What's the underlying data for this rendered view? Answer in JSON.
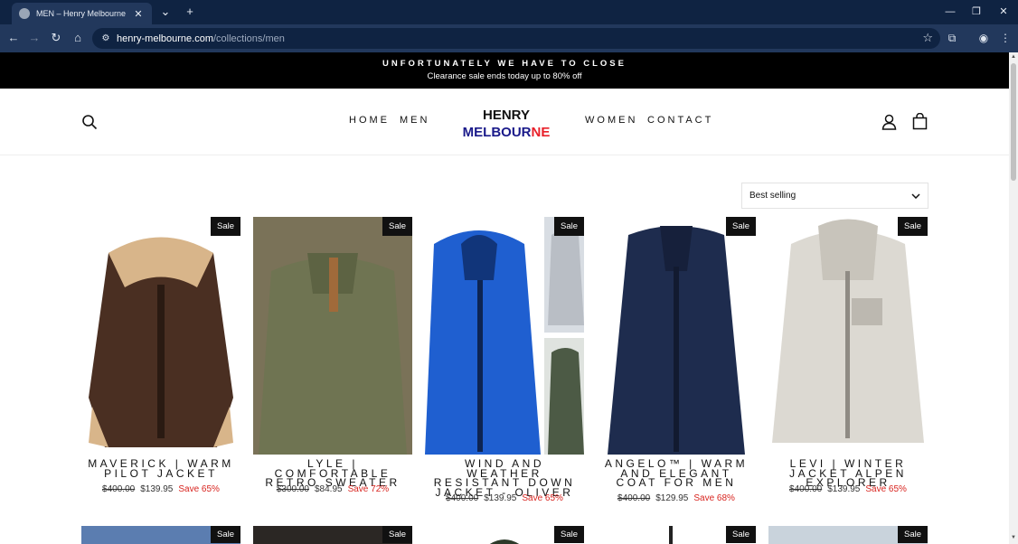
{
  "browser": {
    "tab_title": "MEN – Henry Melbourne",
    "url_host": "henry-melbourne.com",
    "url_path": "/collections/men"
  },
  "announcement": {
    "title": "UNFORTUNATELY WE HAVE TO CLOSE",
    "subtitle": "Clearance sale ends today up to 80% off"
  },
  "header": {
    "nav_left": [
      "HOME",
      "MEN"
    ],
    "nav_right": [
      "WOMEN",
      "CONTACT"
    ],
    "logo_line1": "HENRY",
    "logo_line2_main": "MELBOUR",
    "logo_line2_accent": "NE"
  },
  "sort": {
    "selected": "Best selling"
  },
  "products": [
    {
      "badge": "Sale",
      "title": "MAVERICK | WARM PILOT JACKET",
      "old_price": "$400.00",
      "price": "$139.95",
      "save": "Save 65%"
    },
    {
      "badge": "Sale",
      "title": "LYLE | COMFORTABLE RETRO SWEATER",
      "old_price": "$300.00",
      "price": "$84.95",
      "save": "Save 72%"
    },
    {
      "badge": "Sale",
      "title": "WIND AND WEATHER RESISTANT DOWN JACKET - OLIVER",
      "old_price": "$400.00",
      "price": "$139.95",
      "save": "Save 65%"
    },
    {
      "badge": "Sale",
      "title": "ANGELO™ | WARM AND ELEGANT COAT FOR MEN",
      "old_price": "$400.00",
      "price": "$129.95",
      "save": "Save 68%"
    },
    {
      "badge": "Sale",
      "title": "LEVI | WINTER JACKET ALPEN EXPLORER",
      "old_price": "$400.00",
      "price": "$139.95",
      "save": "Save 65%"
    }
  ],
  "row2_badges": [
    "Sale",
    "Sale",
    "Sale",
    "Sale",
    "Sale"
  ],
  "colors": {
    "announcement_bg": "#000000",
    "logo_blue": "#1a1a8a",
    "logo_red": "#e8202a",
    "save_red": "#d8241f"
  }
}
